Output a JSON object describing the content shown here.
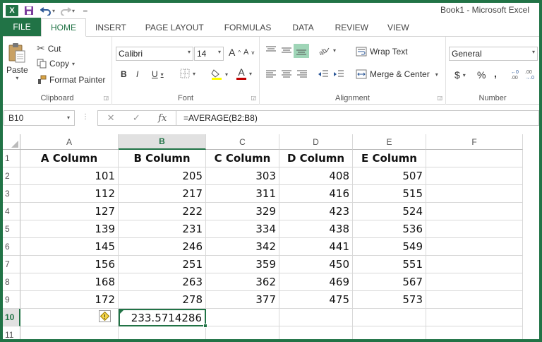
{
  "titlebar": {
    "app_logo": "X",
    "title": "Book1 - Microsoft Excel",
    "icons": [
      "excel-logo-icon",
      "save-icon",
      "undo-icon",
      "redo-icon",
      "customize-icon"
    ]
  },
  "tabs": [
    "FILE",
    "HOME",
    "INSERT",
    "PAGE LAYOUT",
    "FORMULAS",
    "DATA",
    "REVIEW",
    "VIEW"
  ],
  "active_tab": "HOME",
  "ribbon": {
    "clipboard": {
      "label": "Clipboard",
      "paste": "Paste",
      "cut": "Cut",
      "copy": "Copy",
      "format_painter": "Format Painter"
    },
    "font": {
      "label": "Font",
      "font_name": "Calibri",
      "font_size": "14",
      "bold": "B",
      "italic": "I",
      "underline": "U",
      "grow": "A",
      "shrink": "A",
      "font_color_letter": "A",
      "fill_color": "#ffff00",
      "font_color": "#c00000"
    },
    "alignment": {
      "label": "Alignment",
      "wrap_text": "Wrap Text",
      "merge_center": "Merge & Center"
    },
    "number": {
      "label": "Number",
      "format": "General",
      "currency": "$",
      "percent": "%",
      "comma": ","
    }
  },
  "formula_bar": {
    "name_box": "B10",
    "fx": "fx",
    "formula": "=AVERAGE(B2:B8)"
  },
  "grid": {
    "columns": [
      "A",
      "B",
      "C",
      "D",
      "E",
      "F"
    ],
    "selected_column": "B",
    "rows": [
      "1",
      "2",
      "3",
      "4",
      "5",
      "6",
      "7",
      "8",
      "9",
      "10",
      "11"
    ],
    "selected_row": "10",
    "headers": [
      "A Column",
      "B Column",
      "C Column",
      "D Column",
      "E Column"
    ],
    "data": [
      [
        "101",
        "205",
        "303",
        "408",
        "507"
      ],
      [
        "112",
        "217",
        "311",
        "416",
        "515"
      ],
      [
        "127",
        "222",
        "329",
        "423",
        "524"
      ],
      [
        "139",
        "231",
        "334",
        "438",
        "536"
      ],
      [
        "145",
        "246",
        "342",
        "441",
        "549"
      ],
      [
        "156",
        "251",
        "359",
        "450",
        "551"
      ],
      [
        "168",
        "263",
        "362",
        "469",
        "567"
      ],
      [
        "172",
        "278",
        "377",
        "475",
        "573"
      ]
    ],
    "result_cell": "233.5714286",
    "accent_color": "#217346",
    "warning_icon": "error-check-icon"
  }
}
